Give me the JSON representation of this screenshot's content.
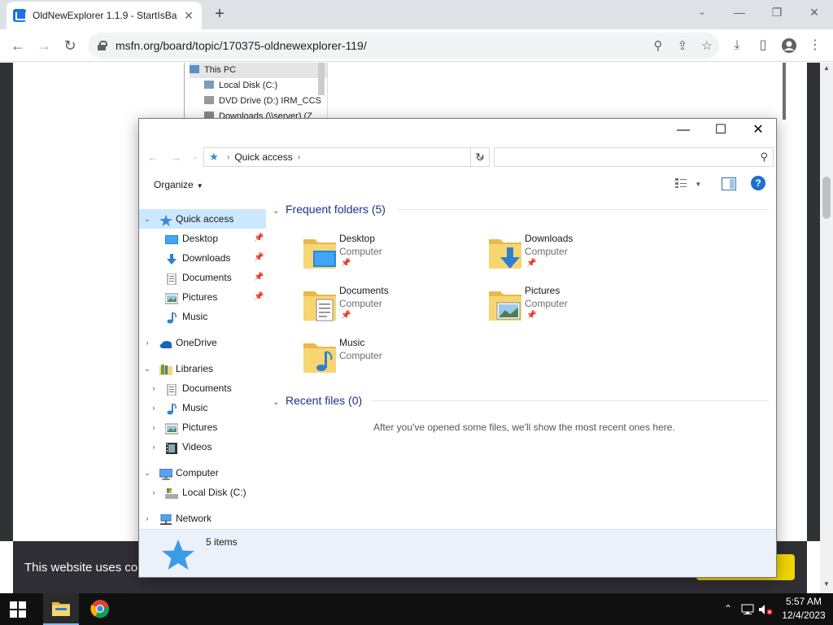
{
  "browser": {
    "tab_title": "OldNewExplorer 1.1.9 - StartIsBa",
    "url": "msfn.org/board/topic/170375-oldnewexplorer-119/"
  },
  "background_page": {
    "tree": [
      "This PC",
      "Local Disk (C:)",
      "DVD Drive (D:) IRM_CCS",
      "Downloads (\\\\server) (Z"
    ],
    "cookie_text": "This website uses co"
  },
  "explorer": {
    "address": {
      "location": "Quick access",
      "search_placeholder": ""
    },
    "organize_label": "Organize",
    "nav": [
      {
        "label": "Quick access",
        "icon": "star-icon",
        "level": 0,
        "expanded": true,
        "selected": true
      },
      {
        "label": "Desktop",
        "icon": "desktop-icon",
        "level": 1,
        "pinned": true
      },
      {
        "label": "Downloads",
        "icon": "downloads-icon",
        "level": 1,
        "pinned": true
      },
      {
        "label": "Documents",
        "icon": "documents-icon",
        "level": 1,
        "pinned": true
      },
      {
        "label": "Pictures",
        "icon": "pictures-icon",
        "level": 1,
        "pinned": true
      },
      {
        "label": "Music",
        "icon": "music-icon",
        "level": 1
      },
      {
        "label": "OneDrive",
        "icon": "cloud-icon",
        "level": 0,
        "expanded": false
      },
      {
        "label": "Libraries",
        "icon": "libraries-icon",
        "level": 0,
        "expanded": true
      },
      {
        "label": "Documents",
        "icon": "documents-icon",
        "level": 1,
        "expanded": false
      },
      {
        "label": "Music",
        "icon": "music-icon",
        "level": 1,
        "expanded": false
      },
      {
        "label": "Pictures",
        "icon": "pictures-icon",
        "level": 1,
        "expanded": false
      },
      {
        "label": "Videos",
        "icon": "videos-icon",
        "level": 1,
        "expanded": false
      },
      {
        "label": "Computer",
        "icon": "computer-icon",
        "level": 0,
        "expanded": true
      },
      {
        "label": "Local Disk (C:)",
        "icon": "drive-icon",
        "level": 1,
        "expanded": false
      },
      {
        "label": "Network",
        "icon": "network-icon",
        "level": 0,
        "expanded": false
      }
    ],
    "frequent_header": "Frequent folders (5)",
    "frequent_folders": [
      {
        "name": "Desktop",
        "location": "Computer",
        "overlay": "desktop",
        "pinned": true
      },
      {
        "name": "Downloads",
        "location": "Computer",
        "overlay": "downloads",
        "pinned": true
      },
      {
        "name": "Documents",
        "location": "Computer",
        "overlay": "documents",
        "pinned": true
      },
      {
        "name": "Pictures",
        "location": "Computer",
        "overlay": "pictures",
        "pinned": true
      },
      {
        "name": "Music",
        "location": "Computer",
        "overlay": "music",
        "pinned": false
      }
    ],
    "recent_header": "Recent files (0)",
    "recent_empty_text": "After you've opened some files, we'll show the most recent ones here.",
    "status_text": "5 items"
  },
  "taskbar": {
    "time": "5:57 AM",
    "date": "12/4/2023"
  },
  "colors": {
    "folder_yellow": "#f7d672",
    "selection_blue": "#cce8ff",
    "group_header": "#1e3287",
    "accent_blue": "#1f6fd1"
  }
}
